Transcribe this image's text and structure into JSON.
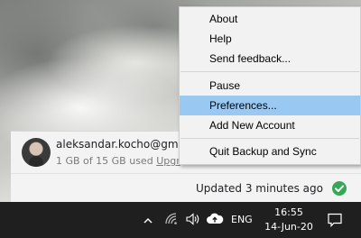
{
  "menu": {
    "items": [
      {
        "label": "About"
      },
      {
        "label": "Help"
      },
      {
        "label": "Send feedback..."
      },
      {
        "label": "Pause"
      },
      {
        "label": "Preferences..."
      },
      {
        "label": "Add New Account"
      },
      {
        "label": "Quit Backup and Sync"
      }
    ],
    "highlighted": "Preferences..."
  },
  "account": {
    "email": "aleksandar.kocho@gma",
    "storage": "1 GB of 15 GB used",
    "upgrade": "Upgr"
  },
  "status": {
    "text": "Updated 3 minutes ago",
    "icon": "check-circle-icon",
    "color": "#34a853"
  },
  "taskbar": {
    "language": "ENG",
    "time": "16:55",
    "date": "14-Jun-20",
    "icons": [
      "chevron-up-icon",
      "wifi-icon",
      "volume-icon",
      "cloud-upload-icon",
      "notification-icon"
    ]
  }
}
